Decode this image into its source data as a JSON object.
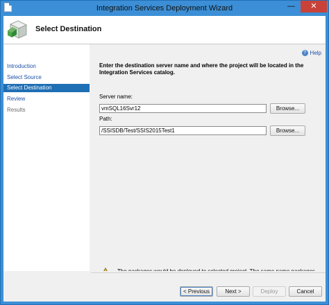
{
  "window": {
    "title": "Integration Services Deployment Wizard",
    "minimize_glyph": "—",
    "close_glyph": "✕"
  },
  "header": {
    "title": "Select Destination"
  },
  "nav": {
    "items": [
      {
        "label": "Introduction"
      },
      {
        "label": "Select Source"
      },
      {
        "label": "Select Destination"
      },
      {
        "label": "Review"
      },
      {
        "label": "Results"
      }
    ]
  },
  "help": {
    "label": "Help",
    "icon_glyph": "?"
  },
  "main": {
    "instruction": "Enter the destination server name and where the project will be located in the Integration Services catalog.",
    "server_label": "Server name:",
    "server_value": "vmSQL16Svr12",
    "browse_label": "Browse...",
    "path_label": "Path:",
    "path_value": "/SSISDB/Test/SSIS2015Test1"
  },
  "warning": {
    "message": "The packages would be deployed to selected project. The same name packages would be replaced."
  },
  "footer": {
    "previous": "< Previous",
    "next": "Next >",
    "deploy": "Deploy",
    "cancel": "Cancel"
  },
  "colors": {
    "titlebar": "#3c8fd6",
    "selected": "#1f6fb5",
    "link": "#1d4fa7",
    "close": "#c9423a"
  }
}
